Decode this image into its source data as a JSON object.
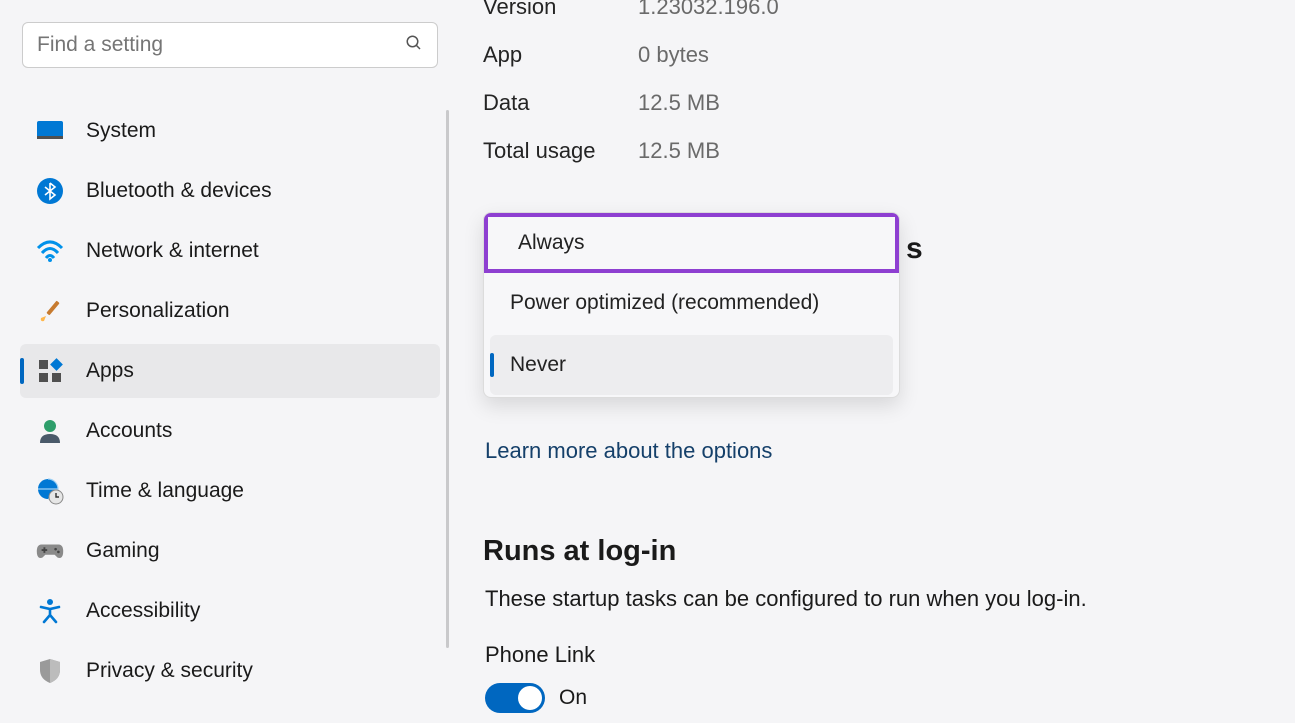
{
  "search": {
    "placeholder": "Find a setting"
  },
  "sidebar": {
    "items": [
      {
        "label": "System"
      },
      {
        "label": "Bluetooth & devices"
      },
      {
        "label": "Network & internet"
      },
      {
        "label": "Personalization"
      },
      {
        "label": "Apps"
      },
      {
        "label": "Accounts"
      },
      {
        "label": "Time & language"
      },
      {
        "label": "Gaming"
      },
      {
        "label": "Accessibility"
      },
      {
        "label": "Privacy & security"
      }
    ]
  },
  "stats": {
    "version": {
      "label": "Version",
      "value": "1.23032.196.0"
    },
    "app": {
      "label": "App",
      "value": "0 bytes"
    },
    "data": {
      "label": "Data",
      "value": "12.5 MB"
    },
    "total": {
      "label": "Total usage",
      "value": "12.5 MB"
    }
  },
  "dropdown": {
    "options": [
      {
        "label": "Always"
      },
      {
        "label": "Power optimized (recommended)"
      },
      {
        "label": "Never"
      }
    ],
    "trailing_letter": "s"
  },
  "learn_link": "Learn more about the options",
  "login_section": {
    "heading": "Runs at log-in",
    "subtitle": "These startup tasks can be configured to run when you log-in.",
    "task": "Phone Link",
    "toggle_state": "On"
  }
}
